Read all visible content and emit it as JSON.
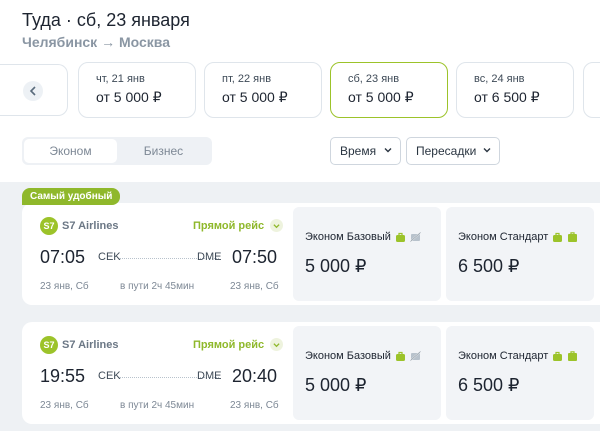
{
  "header": {
    "title": "Туда · сб, 23 января",
    "route": "Челябинск → Москва"
  },
  "dates": [
    {
      "day": "чт, 21 янв",
      "price": "от 5 000 ₽",
      "active": false
    },
    {
      "day": "пт, 22 янв",
      "price": "от 5 000 ₽",
      "active": false
    },
    {
      "day": "сб, 23 янв",
      "price": "от 5 000 ₽",
      "active": true
    },
    {
      "day": "вс, 24 янв",
      "price": "от 6 500 ₽",
      "active": false
    }
  ],
  "dates_prev_icon": "chevron-left-icon",
  "class_toggle": {
    "economy": "Эконом",
    "business": "Бизнес",
    "selected": "economy"
  },
  "filters": {
    "time": "Время",
    "transfers": "Пересадки"
  },
  "badge": "Самый удобный",
  "flights": [
    {
      "airline": "S7 Airlines",
      "logo_text": "S7",
      "direct": "Прямой рейс",
      "dep_time": "07:05",
      "dep_code": "CEK",
      "arr_code": "DME",
      "arr_time": "07:50",
      "dep_date": "23 янв, Сб",
      "duration": "в пути 2ч 45мин",
      "arr_date": "23 янв, Сб",
      "fares": [
        {
          "name": "Эконом Базовый",
          "price": "5 000 ₽"
        },
        {
          "name": "Эконом Стандарт",
          "price": "6 500 ₽"
        }
      ]
    },
    {
      "airline": "S7 Airlines",
      "logo_text": "S7",
      "direct": "Прямой рейс",
      "dep_time": "19:55",
      "dep_code": "CEK",
      "arr_code": "DME",
      "arr_time": "20:40",
      "dep_date": "23 янв, Сб",
      "duration": "в пути 2ч 45мин",
      "arr_date": "23 янв, Сб",
      "fares": [
        {
          "name": "Эконом Базовый",
          "price": "5 000 ₽"
        },
        {
          "name": "Эконом Стандарт",
          "price": "6 500 ₽"
        }
      ]
    }
  ],
  "colors": {
    "accent": "#9cc32a",
    "badge": "#8fb82b",
    "list_bg": "#eef1f4"
  }
}
